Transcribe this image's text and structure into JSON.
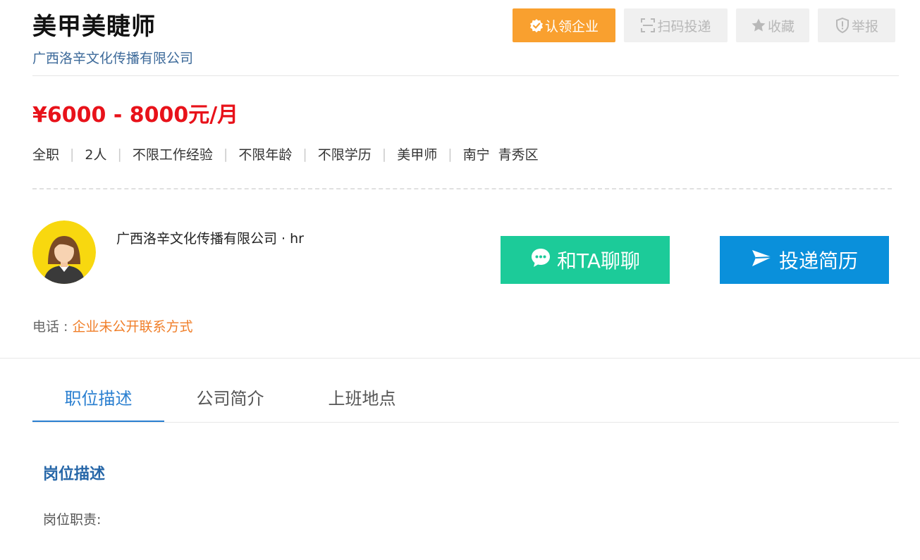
{
  "job": {
    "title": "美甲美睫师",
    "company": "广西洛辛文化传播有限公司",
    "salary": "¥6000 - 8000元/月",
    "tags": [
      "全职",
      "2人",
      "不限工作经验",
      "不限年龄",
      "不限学历",
      "美甲师"
    ],
    "city": "南宁",
    "district": "青秀区"
  },
  "actions": {
    "claim": "认领企业",
    "scan": "扫码投递",
    "favorite": "收藏",
    "report": "举报"
  },
  "contact": {
    "hr_name": "广西洛辛文化传播有限公司 · hr",
    "chat": "和TA聊聊",
    "apply": "投递简历",
    "phone_label": "电话 : ",
    "phone_value": "企业未公开联系方式"
  },
  "tabs": [
    "职位描述",
    "公司简介",
    "上班地点"
  ],
  "description": {
    "heading": "岗位描述",
    "line1": "岗位职责:"
  },
  "colors": {
    "claim_bg": "#f9a02f",
    "salary": "#e8121a",
    "chat_bg": "#1ccb99",
    "apply_bg": "#0a90db",
    "tab_active": "#2a7fd0"
  },
  "icons": {
    "claim": "verified-badge-icon",
    "scan": "scan-icon",
    "favorite": "star-icon",
    "report": "shield-alert-icon",
    "chat": "chat-bubble-icon",
    "apply": "paper-plane-icon"
  }
}
